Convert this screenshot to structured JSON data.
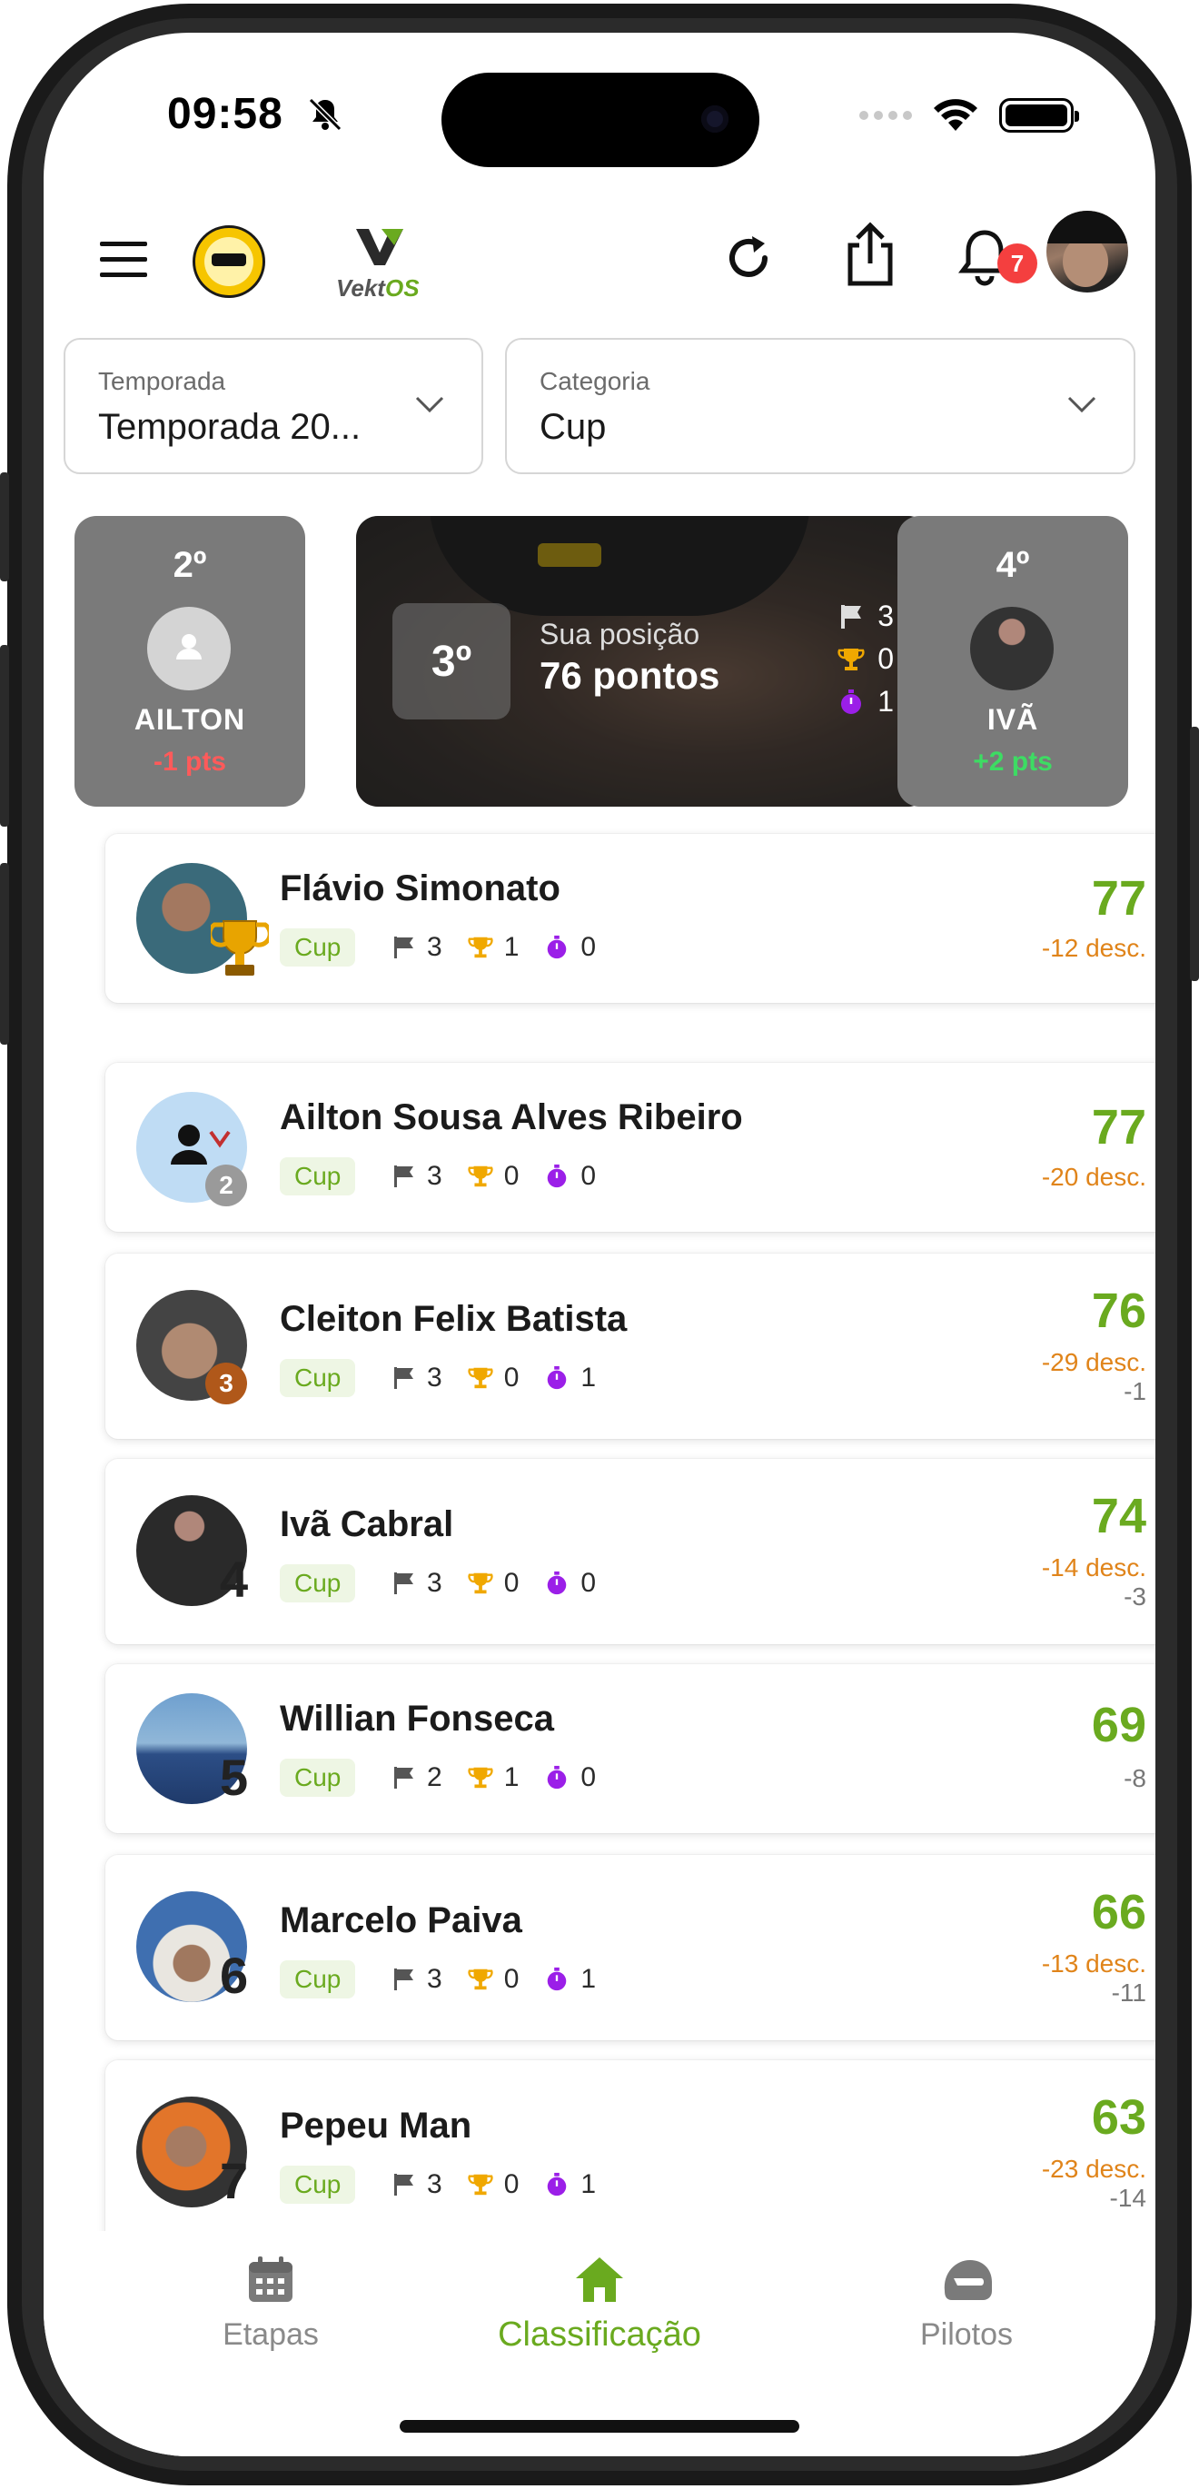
{
  "status_bar": {
    "time": "09:58"
  },
  "header": {
    "menu_icon": "hamburger-menu-icon",
    "logo_kart": "kart-club-logo",
    "logo_app": "VektOS",
    "logo_app_prefix": "Vekt",
    "logo_app_suffix": "OS",
    "refresh_icon": "refresh-icon",
    "share_icon": "share-icon",
    "bell_icon": "bell-icon",
    "notifications_count": "7"
  },
  "filters": {
    "season": {
      "label": "Temporada",
      "value": "Temporada 20..."
    },
    "category": {
      "label": "Categoria",
      "value": "Cup"
    }
  },
  "podium": {
    "left": {
      "position": "2º",
      "name": "AILTON",
      "points_diff": "-1 pts"
    },
    "center": {
      "position": "3º",
      "subtitle": "Sua posição",
      "points": "76 pontos",
      "flags": "3",
      "trophies": "0",
      "fastest_laps": "1"
    },
    "right": {
      "position": "4º",
      "name": "IVÃ",
      "points_diff": "+2 pts"
    }
  },
  "standings": [
    {
      "name": "Flávio Simonato",
      "category": "Cup",
      "flags": "3",
      "trophies": "1",
      "fastest_laps": "0",
      "score": "77",
      "discount": "-12 desc.",
      "diff": ""
    },
    {
      "name": "Ailton Sousa Alves Ribeiro",
      "category": "Cup",
      "flags": "3",
      "trophies": "0",
      "fastest_laps": "0",
      "score": "77",
      "discount": "-20 desc.",
      "diff": "",
      "rank": "2"
    },
    {
      "name": "Cleiton Felix Batista",
      "category": "Cup",
      "flags": "3",
      "trophies": "0",
      "fastest_laps": "1",
      "score": "76",
      "discount": "-29 desc.",
      "diff": "-1",
      "rank": "3"
    },
    {
      "name": "Ivã Cabral",
      "category": "Cup",
      "flags": "3",
      "trophies": "0",
      "fastest_laps": "0",
      "score": "74",
      "discount": "-14 desc.",
      "diff": "-3",
      "rank": "4"
    },
    {
      "name": "Willian Fonseca",
      "category": "Cup",
      "flags": "2",
      "trophies": "1",
      "fastest_laps": "0",
      "score": "69",
      "discount": "",
      "diff": "-8",
      "rank": "5"
    },
    {
      "name": "Marcelo Paiva",
      "category": "Cup",
      "flags": "3",
      "trophies": "0",
      "fastest_laps": "1",
      "score": "66",
      "discount": "-13 desc.",
      "diff": "-11",
      "rank": "6"
    },
    {
      "name": "Pepeu Man",
      "category": "Cup",
      "flags": "3",
      "trophies": "0",
      "fastest_laps": "1",
      "score": "63",
      "discount": "-23 desc.",
      "diff": "-14",
      "rank": "7"
    }
  ],
  "bottom_nav": {
    "items": [
      {
        "label": "Etapas",
        "icon": "calendar-icon"
      },
      {
        "label": "Classificação",
        "icon": "home-icon",
        "active": true
      },
      {
        "label": "Pilotos",
        "icon": "helmet-icon"
      }
    ]
  },
  "colors": {
    "accent": "#6aaa1f",
    "discount": "#e0841a",
    "negative": "#ff5a5a",
    "positive": "#3ddc63",
    "stopwatch": "#9b1fe8",
    "trophy": "#f0a800"
  }
}
